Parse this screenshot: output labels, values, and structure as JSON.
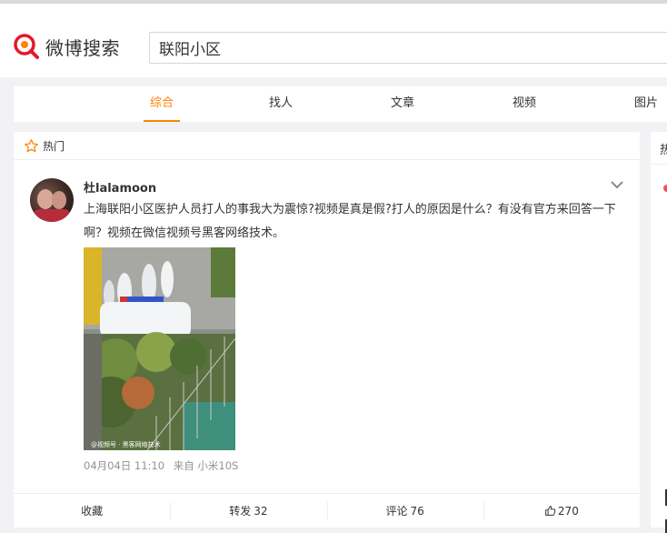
{
  "header": {
    "logo_text": "微博搜索",
    "search_value": "联阳小区"
  },
  "tabs": [
    {
      "label": "综合",
      "active": true
    },
    {
      "label": "找人",
      "active": false
    },
    {
      "label": "文章",
      "active": false
    },
    {
      "label": "视频",
      "active": false
    },
    {
      "label": "图片",
      "active": false
    }
  ],
  "hot_section": {
    "label": "热门",
    "icon": "star-icon"
  },
  "post": {
    "username": "杜lalamoon",
    "text": "上海联阳小区医护人员打人的事我大为震惊?视频是真是假?打人的原因是什么？有没有官方来回答一下啊？视频在微信视频号黑客网络技术。",
    "image_watermark": "@视频号 · 黑客网络技术",
    "date": "04月04日 11:10",
    "source": "来自 小米10S"
  },
  "actions": {
    "collect_label": "收藏",
    "repost_label": "转发",
    "repost_count": "32",
    "comment_label": "评论",
    "comment_count": "76",
    "like_count": "270"
  },
  "side_panel": {
    "head": "热"
  },
  "colors": {
    "accent": "#ff8200",
    "logo_red": "#e6162d",
    "background": "#f2f2f5"
  }
}
